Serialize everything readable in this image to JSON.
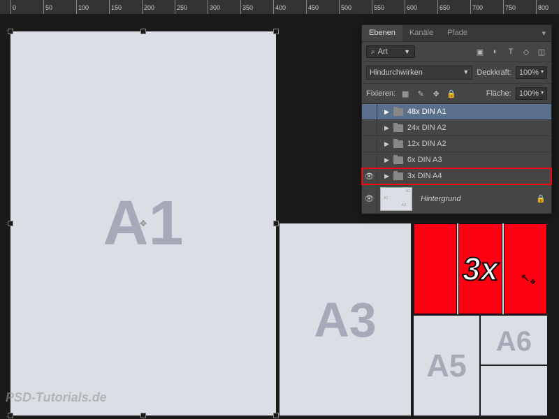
{
  "ruler": {
    "ticks": [
      0,
      50,
      100,
      150,
      200,
      250,
      300,
      350,
      400,
      450,
      500,
      550,
      600,
      650,
      700,
      750,
      800
    ]
  },
  "canvas": {
    "sizes": {
      "a1": "A1",
      "a3": "A3",
      "a5": "A5",
      "a6": "A6"
    },
    "a4_label": "3x"
  },
  "watermark": "PSD-Tutorials.de",
  "panel": {
    "tabs": {
      "layers": "Ebenen",
      "channels": "Kanäle",
      "paths": "Pfade"
    },
    "filter": {
      "label": "Art"
    },
    "blend_mode": "Hindurchwirken",
    "opacity": {
      "label": "Deckkraft:",
      "value": "100%"
    },
    "lock": {
      "label": "Fixieren:"
    },
    "fill": {
      "label": "Fläche:",
      "value": "100%"
    },
    "layers": [
      {
        "name": "48x DIN A1",
        "visible": false,
        "selected": true
      },
      {
        "name": "24x DIN A2",
        "visible": false
      },
      {
        "name": "12x DIN A2",
        "visible": false
      },
      {
        "name": "6x DIN A3",
        "visible": false
      },
      {
        "name": "3x DIN A4",
        "visible": true,
        "highlighted": true
      }
    ],
    "background": {
      "name": "Hintergrund"
    }
  }
}
